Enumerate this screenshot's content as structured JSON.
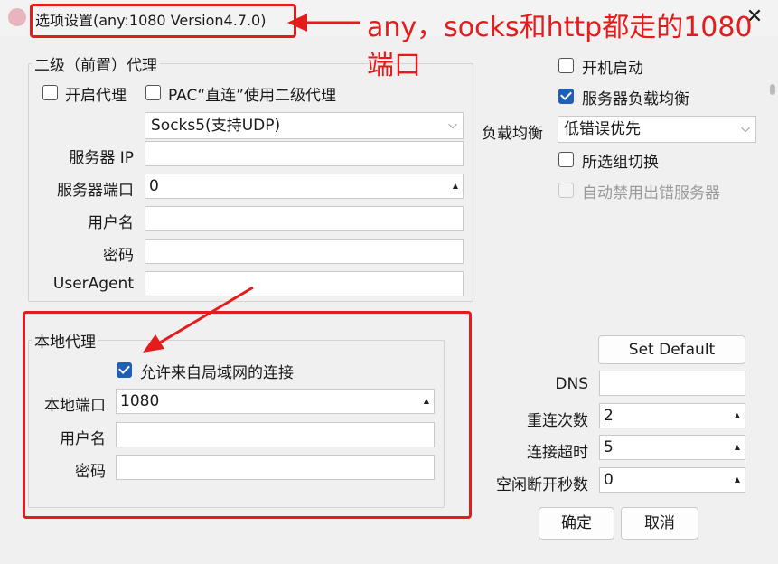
{
  "window": {
    "title": "选项设置(any:1080 Version4.7.0)",
    "close_glyph": "✕"
  },
  "secondary_proxy": {
    "group_label": "二级（前置）代理",
    "enable_label": "开启代理",
    "enable_checked": false,
    "pac_direct_label": "PAC“直连”使用二级代理",
    "pac_direct_checked": false,
    "protocol_value": "Socks5(支持UDP)",
    "server_ip_label": "服务器 IP",
    "server_ip_value": "",
    "server_port_label": "服务器端口",
    "server_port_value": "0",
    "username_label": "用户名",
    "username_value": "",
    "password_label": "密码",
    "password_value": "",
    "useragent_label": "UserAgent",
    "useragent_value": ""
  },
  "local_proxy": {
    "group_label": "本地代理",
    "allow_lan_label": "允许来自局域网的连接",
    "allow_lan_checked": true,
    "port_label": "本地端口",
    "port_value": "1080",
    "username_label": "用户名",
    "username_value": "",
    "password_label": "密码",
    "password_value": ""
  },
  "right_panel": {
    "autostart_label": "开机启动",
    "autostart_checked": false,
    "load_balance_label": "服务器负载均衡",
    "load_balance_checked": true,
    "balance_mode_label": "负载均衡",
    "balance_mode_value": "低错误优先",
    "group_switch_label": "所选组切换",
    "group_switch_checked": false,
    "auto_disable_label": "自动禁用出错服务器",
    "auto_disable_checked": false,
    "set_default_label": "Set Default",
    "dns_label": "DNS",
    "dns_value": "",
    "retry_label": "重连次数",
    "retry_value": "2",
    "timeout_label": "连接超时",
    "timeout_value": "5",
    "idle_label": "空闲断开秒数",
    "idle_value": "0"
  },
  "buttons": {
    "ok_label": "确定",
    "cancel_label": "取消"
  },
  "annotation": {
    "text_line1": "any，socks和http都走的1080",
    "text_line2": "端口",
    "color": "#e41c1c"
  },
  "icons": {
    "spin_up": "▲",
    "spin_down": "▼",
    "dropdown": "⌵"
  }
}
